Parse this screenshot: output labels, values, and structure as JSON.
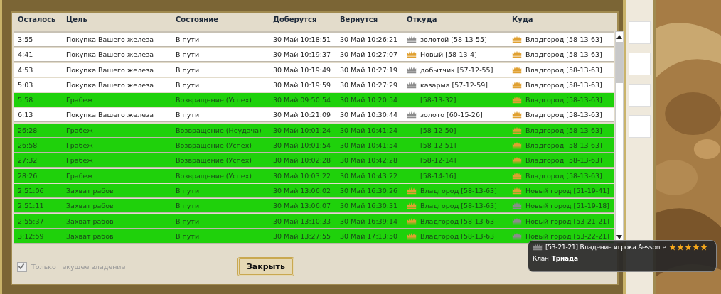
{
  "table": {
    "columns": [
      "Осталось",
      "Цель",
      "Состояние",
      "Доберутся",
      "Вернутся",
      "Откуда",
      "Куда"
    ],
    "rows": [
      {
        "highlighted": false,
        "left": "3:55",
        "goal": "Покупка Вашего железа",
        "state": "В пути",
        "arrive": "30 Май 10:18:51",
        "return": "30 Май 10:26:21",
        "from": {
          "color": "#8c8c8c",
          "label": "золотой [58-13-55]"
        },
        "to": {
          "color": "#e0a030",
          "label": "Владгород [58-13-63]"
        }
      },
      {
        "highlighted": false,
        "left": "4:41",
        "goal": "Покупка Вашего железа",
        "state": "В пути",
        "arrive": "30 Май 10:19:37",
        "return": "30 Май 10:27:07",
        "from": {
          "color": "#e0a030",
          "label": "Новый [58-13-4]"
        },
        "to": {
          "color": "#e0a030",
          "label": "Владгород [58-13-63]"
        }
      },
      {
        "highlighted": false,
        "left": "4:53",
        "goal": "Покупка Вашего железа",
        "state": "В пути",
        "arrive": "30 Май 10:19:49",
        "return": "30 Май 10:27:19",
        "from": {
          "color": "#8c8c8c",
          "label": "добытчик [57-12-55]"
        },
        "to": {
          "color": "#e0a030",
          "label": "Владгород [58-13-63]"
        }
      },
      {
        "highlighted": false,
        "left": "5:03",
        "goal": "Покупка Вашего железа",
        "state": "В пути",
        "arrive": "30 Май 10:19:59",
        "return": "30 Май 10:27:29",
        "from": {
          "color": "#8c8c8c",
          "label": "казарма [57-12-59]"
        },
        "to": {
          "color": "#e0a030",
          "label": "Владгород [58-13-63]"
        }
      },
      {
        "highlighted": true,
        "left": "5:58",
        "goal": "Грабеж",
        "state": "Возвращение (Успех)",
        "arrive": "30 Май 09:50:54",
        "return": "30 Май 10:20:54",
        "from": {
          "label": "[58-13-32]"
        },
        "to": {
          "color": "#e0a030",
          "label": "Владгород [58-13-63]"
        }
      },
      {
        "highlighted": false,
        "left": "6:13",
        "goal": "Покупка Вашего железа",
        "state": "В пути",
        "arrive": "30 Май 10:21:09",
        "return": "30 Май 10:30:44",
        "from": {
          "color": "#8c8c8c",
          "label": "золото [60-15-26]"
        },
        "to": {
          "color": "#e0a030",
          "label": "Владгород [58-13-63]"
        }
      },
      {
        "highlighted": true,
        "left": "26:28",
        "goal": "Грабеж",
        "state": "Возвращение (Неудача)",
        "arrive": "30 Май 10:01:24",
        "return": "30 Май 10:41:24",
        "from": {
          "label": "[58-12-50]"
        },
        "to": {
          "color": "#e0a030",
          "label": "Владгород [58-13-63]"
        }
      },
      {
        "highlighted": true,
        "left": "26:58",
        "goal": "Грабеж",
        "state": "Возвращение (Успех)",
        "arrive": "30 Май 10:01:54",
        "return": "30 Май 10:41:54",
        "from": {
          "label": "[58-12-51]"
        },
        "to": {
          "color": "#e0a030",
          "label": "Владгород [58-13-63]"
        }
      },
      {
        "highlighted": true,
        "left": "27:32",
        "goal": "Грабеж",
        "state": "Возвращение (Успех)",
        "arrive": "30 Май 10:02:28",
        "return": "30 Май 10:42:28",
        "from": {
          "label": "[58-12-14]"
        },
        "to": {
          "color": "#e0a030",
          "label": "Владгород [58-13-63]"
        }
      },
      {
        "highlighted": true,
        "left": "28:26",
        "goal": "Грабеж",
        "state": "Возвращение (Успех)",
        "arrive": "30 Май 10:03:22",
        "return": "30 Май 10:43:22",
        "from": {
          "label": "[58-14-16]"
        },
        "to": {
          "color": "#e0a030",
          "label": "Владгород [58-13-63]"
        }
      },
      {
        "highlighted": true,
        "left": "2:51:06",
        "goal": "Захват рабов",
        "state": "В пути",
        "arrive": "30 Май 13:06:02",
        "return": "30 Май 16:30:26",
        "from": {
          "color": "#e0a030",
          "label": "Владгород [58-13-63]"
        },
        "to": {
          "color": "#e0a030",
          "label": "Новый город [51-19-41]"
        }
      },
      {
        "highlighted": true,
        "left": "2:51:11",
        "goal": "Захват рабов",
        "state": "В пути",
        "arrive": "30 Май 13:06:07",
        "return": "30 Май 16:30:31",
        "from": {
          "color": "#e0a030",
          "label": "Владгород [58-13-63]"
        },
        "to": {
          "color": "#8c8c8c",
          "label": "Новый город [51-19-18]"
        }
      },
      {
        "highlighted": true,
        "left": "2:55:37",
        "goal": "Захват рабов",
        "state": "В пути",
        "arrive": "30 Май 13:10:33",
        "return": "30 Май 16:39:14",
        "from": {
          "color": "#e0a030",
          "label": "Владгород [58-13-63]"
        },
        "to": {
          "color": "#8c8c8c",
          "label": "Новый город [53-21-21]"
        }
      },
      {
        "highlighted": true,
        "left": "3:12:59",
        "goal": "Захват рабов",
        "state": "В пути",
        "arrive": "30 Май 13:27:55",
        "return": "30 Май 17:13:50",
        "from": {
          "color": "#e0a030",
          "label": "Владгород [58-13-63]"
        },
        "to": {
          "color": "#8c8c8c",
          "label": "Новый город [53-22-21]"
        }
      }
    ]
  },
  "current_only": {
    "label": "Только текущее владение",
    "checked": true,
    "disabled": true
  },
  "close_button": "Закрыть",
  "tooltip": {
    "title": "[53-21-21] Владение игрока Aessonte",
    "stars": 5,
    "clan_label": "Клан",
    "clan": "Триада"
  }
}
